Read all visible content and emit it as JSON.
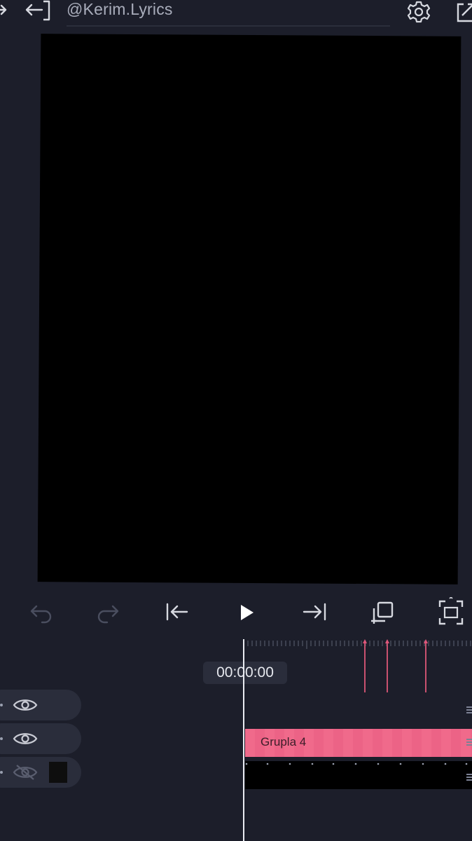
{
  "header": {
    "project_name": "@Kerim.Lyrics"
  },
  "icons": {
    "back": "back-arrow-icon",
    "settings": "gear-icon",
    "export": "export-icon",
    "undo": "undo-icon",
    "redo": "redo-icon",
    "skip_start": "skip-to-start-icon",
    "play": "play-icon",
    "skip_end": "skip-to-end-icon",
    "duplicate": "duplicate-icon",
    "fit": "fit-screen-icon",
    "eye": "eye-icon",
    "eye_hidden": "eye-off-icon"
  },
  "timeline": {
    "current_time": "00:00:00",
    "layers": [
      {
        "visible": true
      },
      {
        "visible": true,
        "clip_label": "Grupla 4"
      },
      {
        "visible": false
      }
    ]
  },
  "colors": {
    "background": "#1c1e2a",
    "panel": "#2a2d3b",
    "clip": "#f06a8b",
    "keyframe": "#c9516f"
  }
}
